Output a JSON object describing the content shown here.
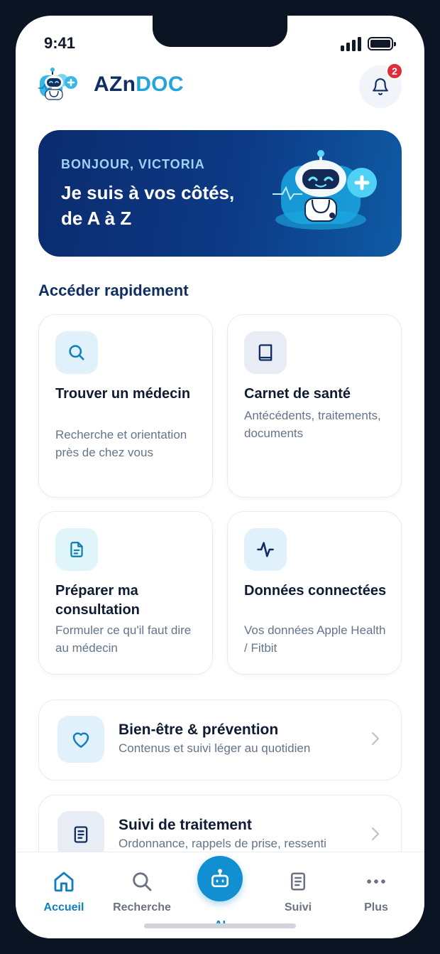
{
  "status_bar": {
    "time": "9:41"
  },
  "header": {
    "brand_part1": "AZn",
    "brand_part2": "DOC",
    "notification_count": "2",
    "logo_icon": "robot-doctor-icon",
    "bell_icon": "bell-icon"
  },
  "hero": {
    "greeting": "BONJOUR, VICTORIA",
    "title_line1": "Je suis à vos côtés,",
    "title_line2": "de A à Z"
  },
  "quick_access": {
    "title": "Accéder rapidement",
    "cards": [
      {
        "title": "Trouver un médecin",
        "description": "Recherche et orientation près de chez vous",
        "icon": "search-icon"
      },
      {
        "title": "Carnet de santé",
        "description": "Antécédents, traitements, documents",
        "icon": "book-icon"
      },
      {
        "title": "Préparer ma consultation",
        "description": "Formuler ce qu'il faut dire au médecin",
        "icon": "document-icon"
      },
      {
        "title": "Données connectées",
        "description": "Vos données Apple Health / Fitbit",
        "icon": "activity-icon"
      }
    ]
  },
  "list_items": [
    {
      "title": "Bien-être & prévention",
      "description": "Contenus et suivi léger au quotidien",
      "icon": "heart-icon"
    },
    {
      "title": "Suivi de traitement",
      "description": "Ordonnance, rappels de prise, ressenti",
      "icon": "clipboard-icon"
    }
  ],
  "tab_bar": {
    "tabs": [
      {
        "label": "Accueil",
        "icon": "home-icon",
        "active": true
      },
      {
        "label": "Recherche",
        "icon": "search-icon"
      },
      {
        "label": "AI",
        "icon": "robot-icon"
      },
      {
        "label": "Suivi",
        "icon": "clipboard-icon"
      },
      {
        "label": "Plus",
        "icon": "more-icon"
      }
    ]
  },
  "colors": {
    "navy": "#0f2f63",
    "accent": "#23a4dc",
    "tab_active": "#0f7fc0",
    "badge": "#e02d3c"
  }
}
